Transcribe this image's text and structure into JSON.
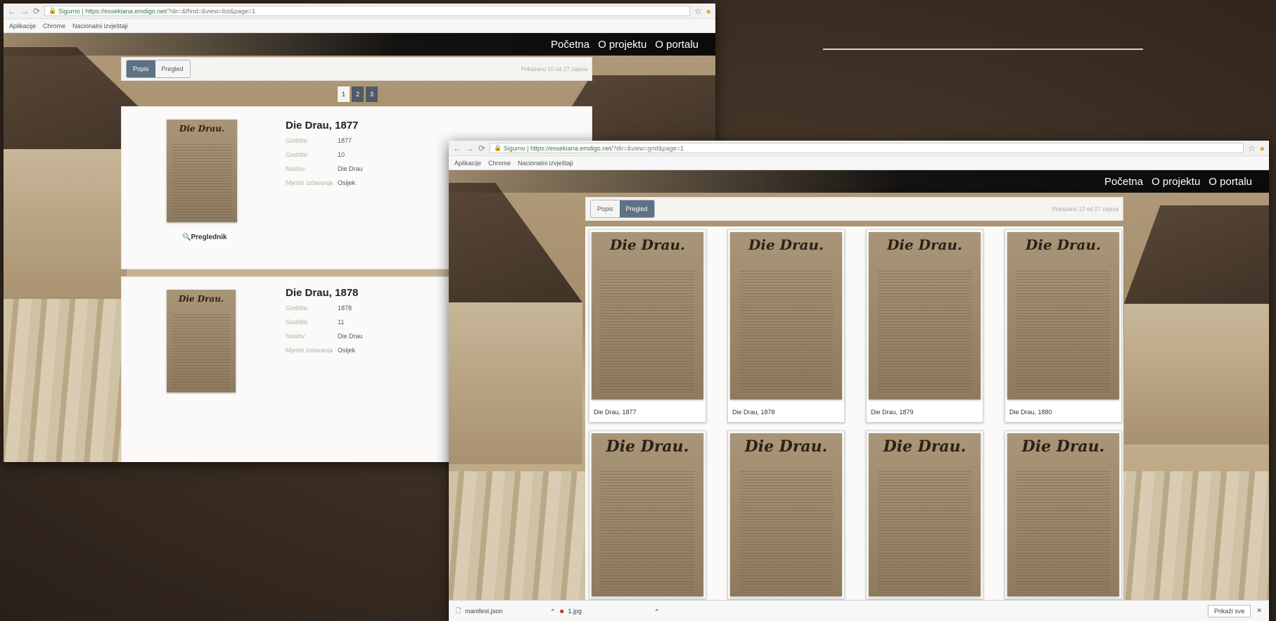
{
  "browser_back": {
    "url_host": "https://essekiana.emdigo.net",
    "url_path": "/?dir=&ffind=&view=list&page=1",
    "secure_label": "Sigurno",
    "bookmarks": [
      "Aplikacije",
      "Chrome",
      "Nacionalni izvještaji"
    ]
  },
  "browser_front": {
    "url_host": "https://essekiana.emdigo.net",
    "url_path": "/?dir=&view=grid&page=1",
    "secure_label": "Sigurno",
    "bookmarks": [
      "Aplikacije",
      "Chrome",
      "Nacionalni izvještaji"
    ]
  },
  "nav": {
    "home": "Početna",
    "about_project": "O projektu",
    "about_portal": "O portalu"
  },
  "view_toggle": {
    "list": "Popis",
    "grid": "Pregled"
  },
  "back_count": "Prikazano 10 od 27 zapisa",
  "front_count": "Prikazano 12 od 27 zapisa",
  "pagination": [
    "1",
    "2",
    "3"
  ],
  "list_labels": {
    "year": "Godište",
    "issues": "Godište",
    "title": "Naslov",
    "place": "Mjesto izdavanja"
  },
  "list_items": [
    {
      "title": "Die Drau, 1877",
      "year": "1877",
      "issues": "10",
      "name": "Die Drau",
      "place": "Osijek",
      "viewer": "Preglednik",
      "masthead": "Die Drau."
    },
    {
      "title": "Die Drau, 1878",
      "year": "1878",
      "issues": "11",
      "name": "Die Drau",
      "place": "Osijek",
      "masthead": "Die Drau."
    }
  ],
  "grid_items": [
    {
      "caption": "Die Drau, 1877",
      "masthead": "Die Drau."
    },
    {
      "caption": "Die Drau, 1878",
      "masthead": "Die Drau."
    },
    {
      "caption": "Die Drau, 1879",
      "masthead": "Die Drau."
    },
    {
      "caption": "Die Drau, 1880",
      "masthead": "Die Drau."
    },
    {
      "caption": "",
      "masthead": "Die Drau."
    },
    {
      "caption": "",
      "masthead": "Die Drau."
    },
    {
      "caption": "",
      "masthead": "Die Drau."
    },
    {
      "caption": "",
      "masthead": "Die Drau."
    }
  ],
  "downloads": {
    "file1": "manifest.json",
    "file2": "1.jpg",
    "show_all": "Prikaži sve"
  },
  "colors": {
    "accent": "#5e7185",
    "navbar": "#141210",
    "sepia": "#b09a7a"
  }
}
